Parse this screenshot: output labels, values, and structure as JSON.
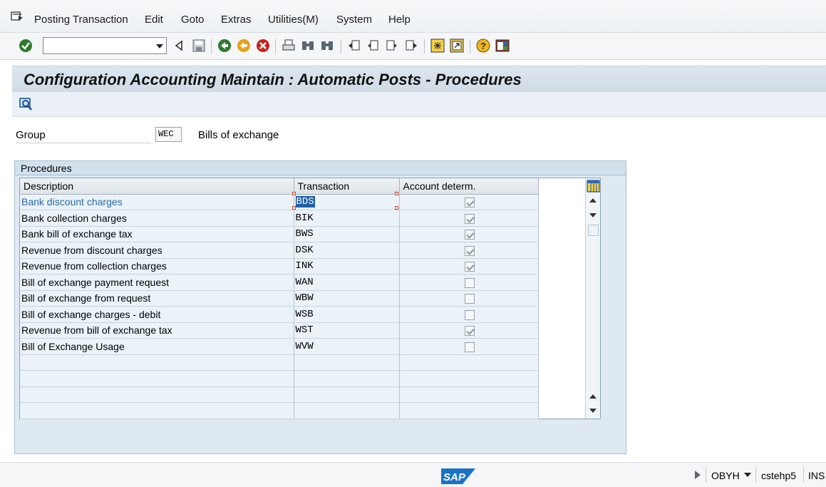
{
  "menubar": {
    "items": [
      "Posting Transaction",
      "Edit",
      "Goto",
      "Extras",
      "Utilities(M)",
      "System",
      "Help"
    ]
  },
  "toolbar": {
    "command_value": "",
    "icons": [
      "enter-check-icon",
      "save-icon",
      "back-icon",
      "exit-icon",
      "cancel-icon",
      "print-icon",
      "find-icon",
      "find-next-icon",
      "first-page-icon",
      "previous-page-icon",
      "next-page-icon",
      "last-page-icon",
      "create-session-icon",
      "shortcut-icon",
      "help-icon",
      "layout-icon"
    ]
  },
  "title": "Configuration Accounting Maintain : Automatic Posts - Procedures",
  "group": {
    "label": "Group",
    "value": "WEC",
    "text": "Bills of exchange"
  },
  "procedures": {
    "box_title": "Procedures",
    "columns": [
      "Description",
      "Transaction",
      "Account determ."
    ],
    "rows": [
      {
        "description": "Bank discount charges",
        "transaction": "BDS",
        "account_determ": true
      },
      {
        "description": "Bank collection charges",
        "transaction": "BIK",
        "account_determ": true
      },
      {
        "description": "Bank bill of exchange tax",
        "transaction": "BWS",
        "account_determ": true
      },
      {
        "description": "Revenue from discount charges",
        "transaction": "DSK",
        "account_determ": true
      },
      {
        "description": "Revenue from collection charges",
        "transaction": "INK",
        "account_determ": true
      },
      {
        "description": "Bill of exchange payment request",
        "transaction": "WAN",
        "account_determ": false
      },
      {
        "description": "Bill of exchange from request",
        "transaction": "WBW",
        "account_determ": false
      },
      {
        "description": "Bill of exchange charges - debit",
        "transaction": "WSB",
        "account_determ": false
      },
      {
        "description": "Revenue from bill of exchange tax",
        "transaction": "WST",
        "account_determ": true
      },
      {
        "description": "Bill of Exchange Usage",
        "transaction": "WVW",
        "account_determ": false
      }
    ],
    "empty_rows": 4
  },
  "statusbar": {
    "logo": "SAP",
    "transaction": "OBYH",
    "server": "cstehp5",
    "mode": "INS"
  },
  "colors": {
    "title_bg": "#d5e0ea",
    "grid_row_bg": "#ebf2f8",
    "link": "#2b6aa8",
    "selection": "#1f5fa8"
  }
}
